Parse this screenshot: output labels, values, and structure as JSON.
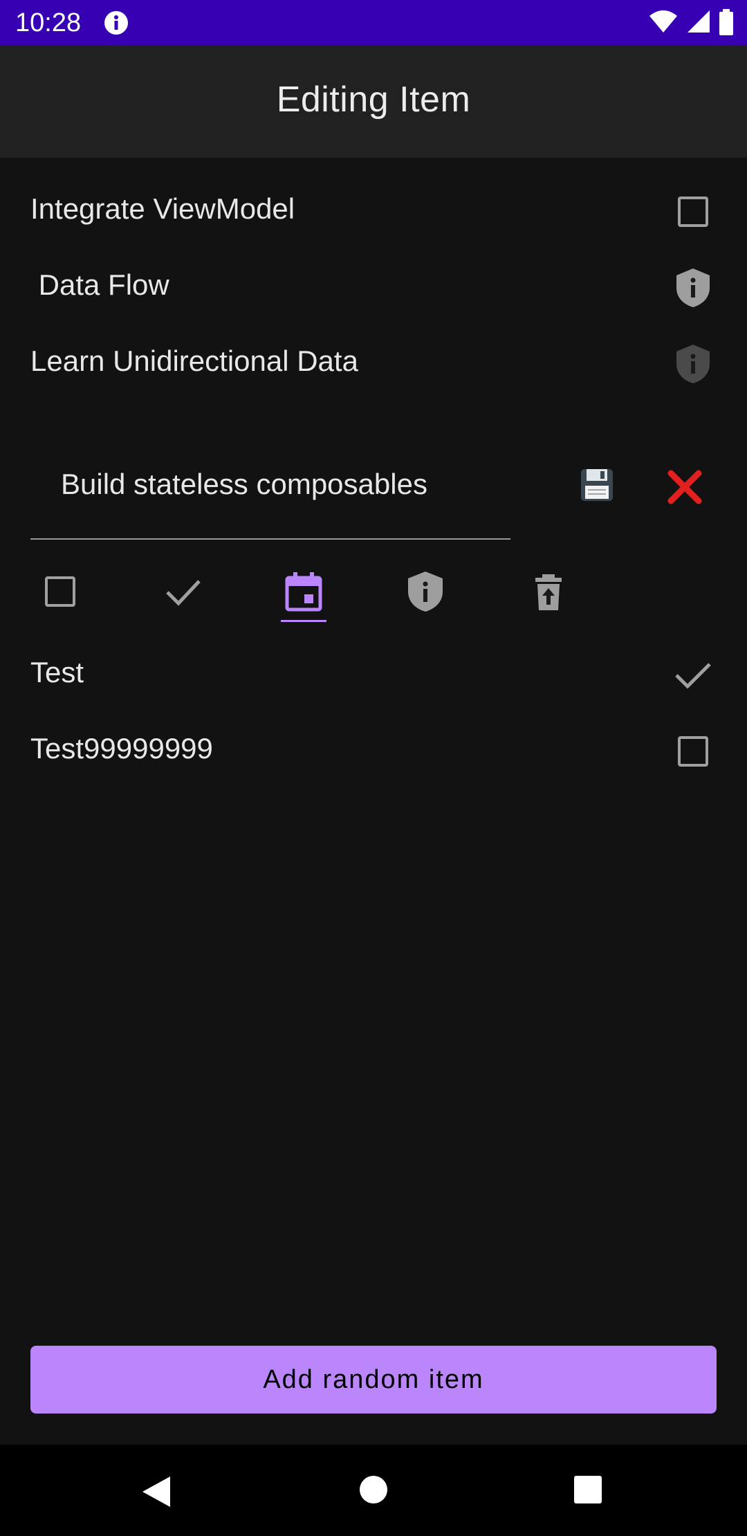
{
  "status_bar": {
    "time": "10:28"
  },
  "app_bar": {
    "title": "Editing Item"
  },
  "items": [
    {
      "text": "Integrate ViewModel",
      "icon": "checkbox-empty-icon"
    },
    {
      "text": " Data Flow",
      "icon": "shield-info-icon"
    },
    {
      "text": "Learn Unidirectional Data",
      "icon": "shield-info-icon"
    }
  ],
  "editor": {
    "value": "Build stateless composables",
    "save_icon": "floppy-disk-icon",
    "cancel_icon": "red-x-icon",
    "icon_options": [
      "checkbox-empty-icon",
      "check-icon",
      "calendar-event-icon",
      "shield-info-icon",
      "restore-from-trash-icon"
    ],
    "selected_icon": "calendar-event-icon",
    "accent_color": "#bb86fc"
  },
  "items_below": [
    {
      "text": "Test",
      "icon": "check-icon"
    },
    {
      "text": "Test99999999",
      "icon": "checkbox-empty-icon"
    }
  ],
  "add_button": {
    "label": "Add random item"
  },
  "colors": {
    "status_bar": "#3700b3",
    "app_bar": "#212121",
    "background": "#121212",
    "accent": "#bb86fc",
    "cancel": "#e32020"
  }
}
